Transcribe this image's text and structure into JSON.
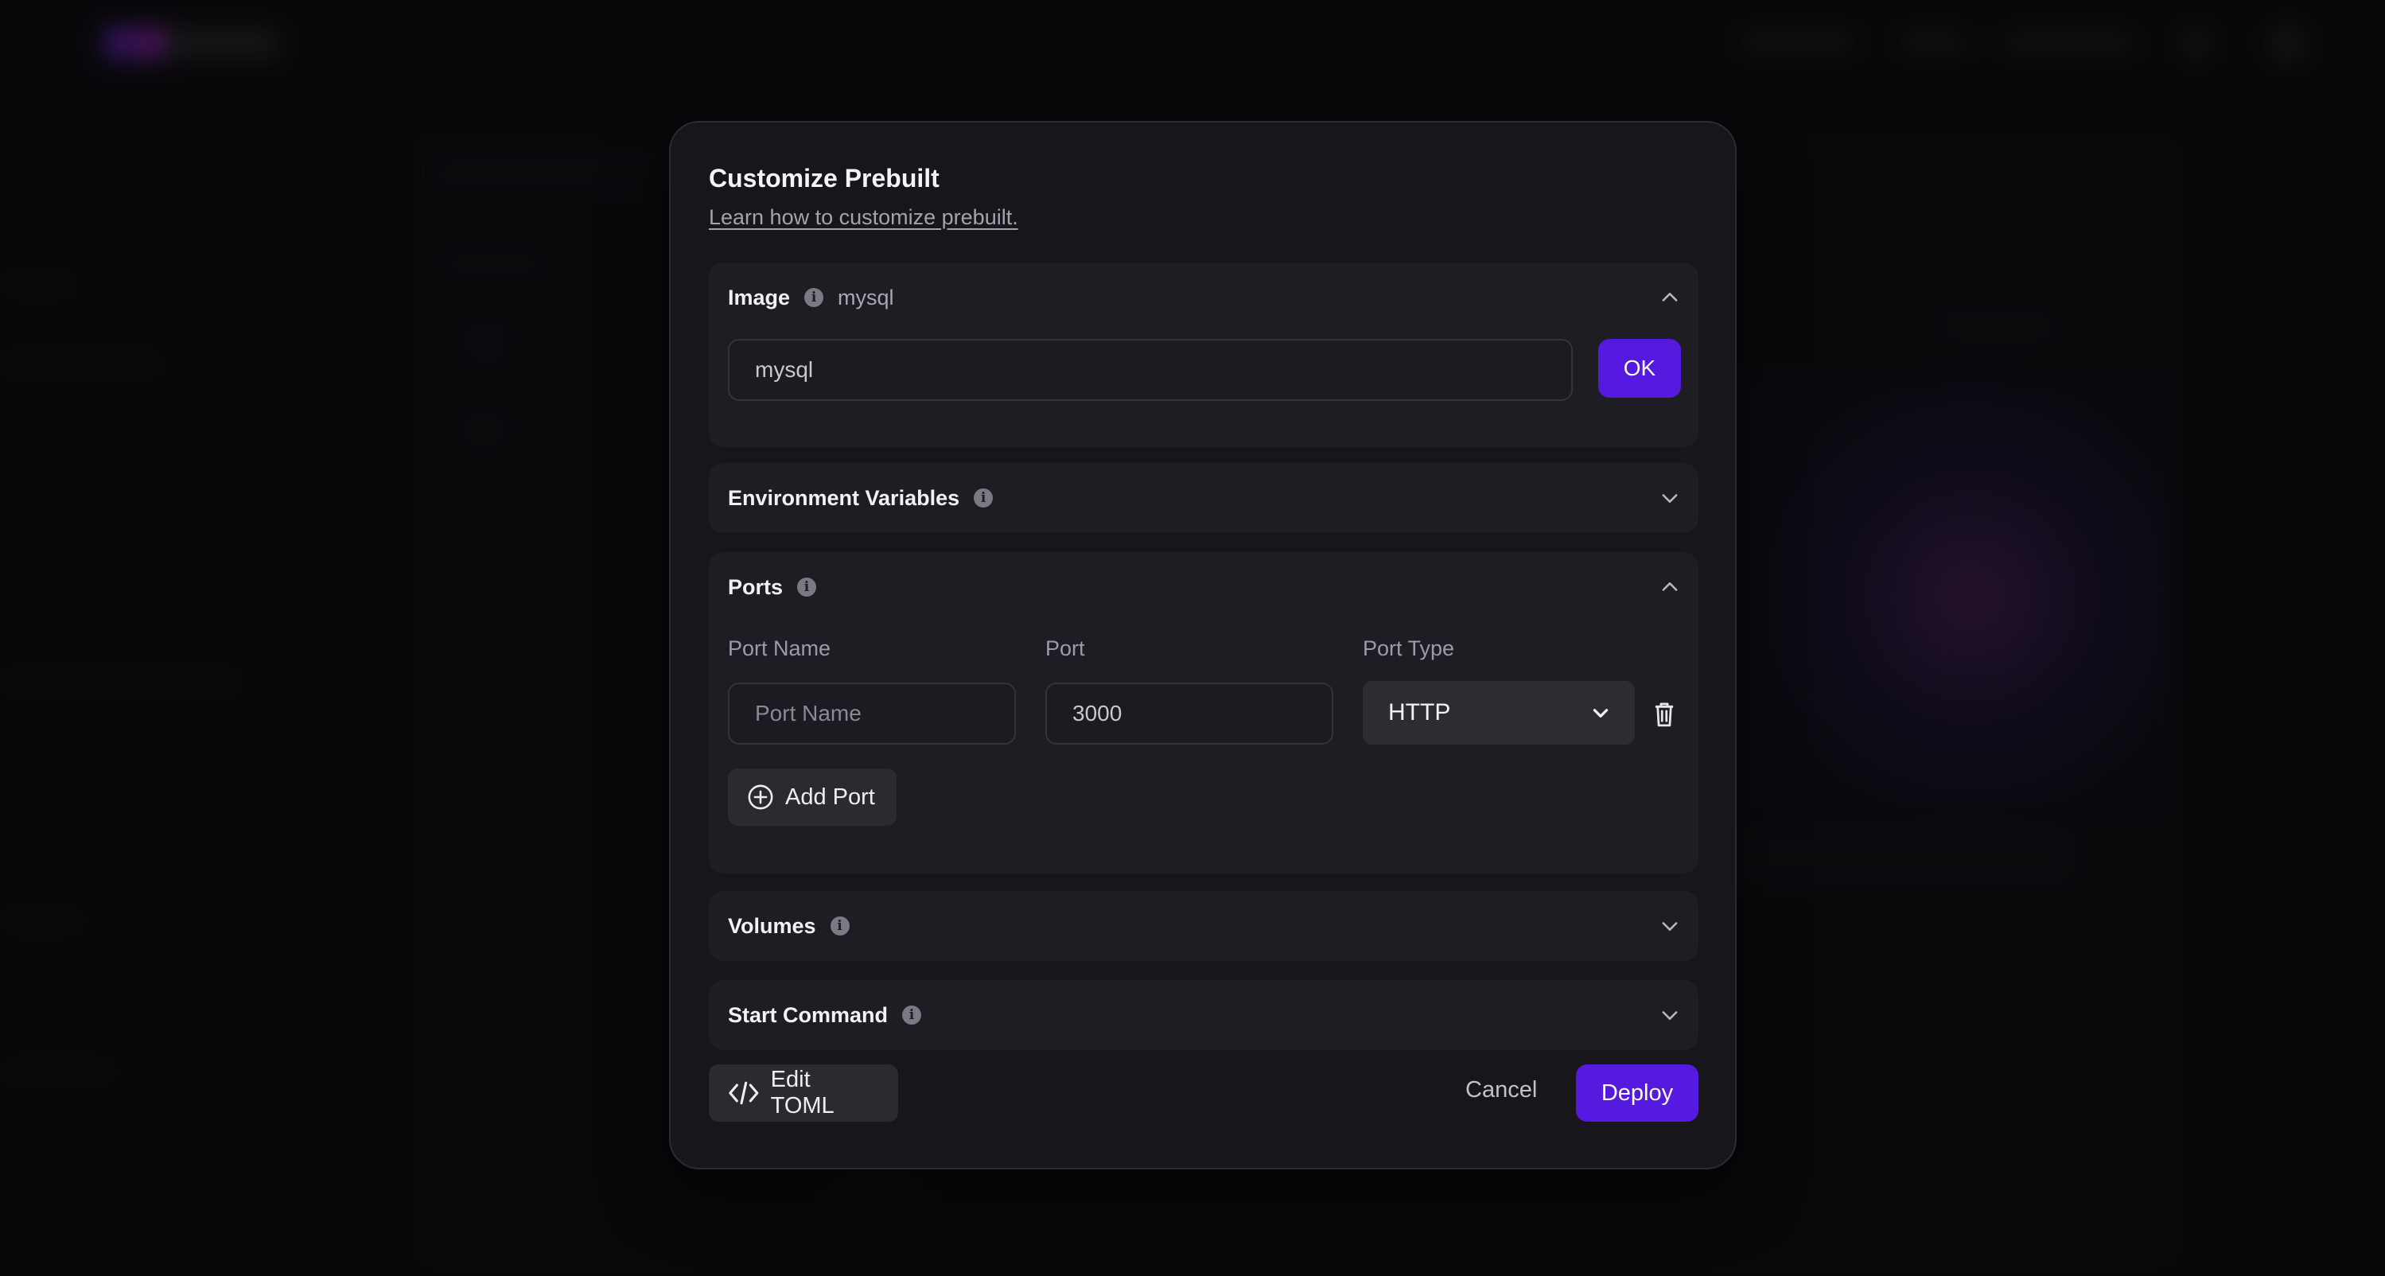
{
  "modal": {
    "title": "Customize Prebuilt",
    "help_link": "Learn how to customize prebuilt."
  },
  "image_section": {
    "title": "Image",
    "current_value": "mysql",
    "input_value": "mysql",
    "ok_label": "OK",
    "expanded": true
  },
  "env_section": {
    "title": "Environment Variables",
    "expanded": false
  },
  "ports_section": {
    "title": "Ports",
    "expanded": true,
    "labels": {
      "name": "Port Name",
      "port": "Port",
      "type": "Port Type"
    },
    "row": {
      "name_placeholder": "Port Name",
      "port_value": "3000",
      "type_value": "HTTP"
    },
    "add_label": "Add Port"
  },
  "volumes_section": {
    "title": "Volumes",
    "expanded": false
  },
  "start_section": {
    "title": "Start Command",
    "expanded": false
  },
  "footer": {
    "edit_toml_label": "Edit TOML",
    "cancel_label": "Cancel",
    "deploy_label": "Deploy"
  },
  "colors": {
    "accent": "#5519e0",
    "modal_bg": "#17161b",
    "section_bg": "#1e1d23"
  }
}
